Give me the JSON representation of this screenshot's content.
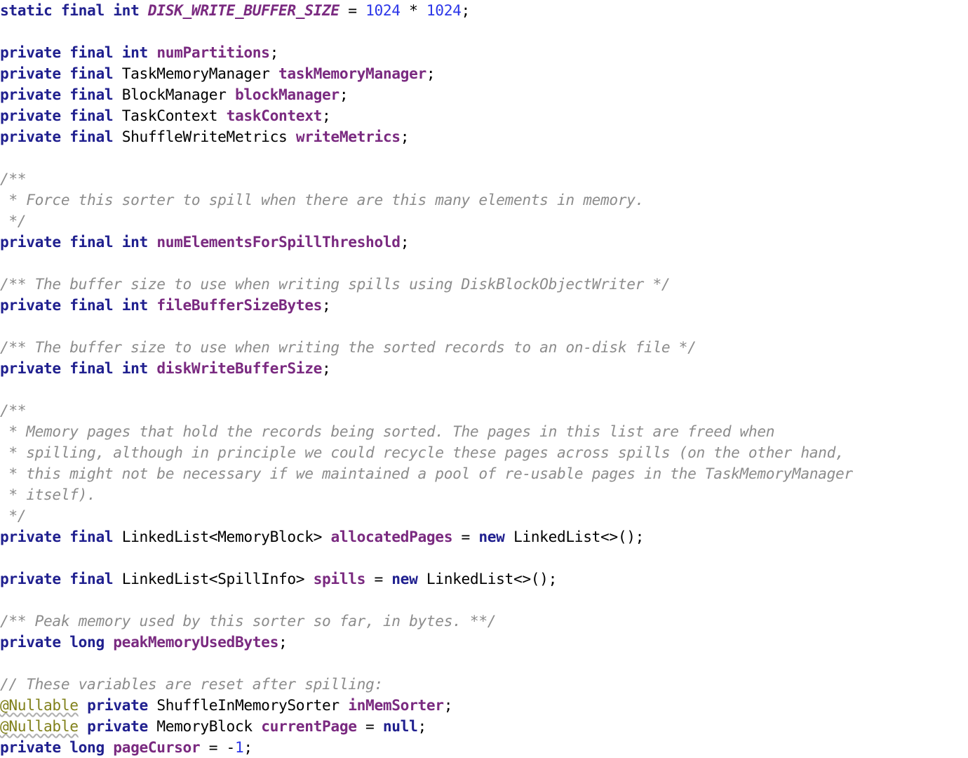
{
  "editor": {
    "language": "java",
    "background_color": "#ffffff",
    "font_size_px": 21,
    "line_height_px": 30,
    "palette": {
      "keyword": "#20208f",
      "field": "#7a2a80",
      "constant": "#7a2a80",
      "number": "#2b36e8",
      "comment": "#8c8c8c",
      "annotation": "#80801a",
      "plain": "#000000"
    }
  },
  "code": {
    "lines": [
      {
        "index": 1,
        "text": "static final int DISK_WRITE_BUFFER_SIZE = 1024 * 1024;",
        "tokens": [
          {
            "t": "static",
            "c": "keyword"
          },
          {
            "t": " ",
            "c": "plain"
          },
          {
            "t": "final",
            "c": "keyword"
          },
          {
            "t": " ",
            "c": "plain"
          },
          {
            "t": "int",
            "c": "keyword"
          },
          {
            "t": " ",
            "c": "plain"
          },
          {
            "t": "DISK_WRITE_BUFFER_SIZE",
            "c": "const"
          },
          {
            "t": " = ",
            "c": "plain"
          },
          {
            "t": "1024",
            "c": "number"
          },
          {
            "t": " * ",
            "c": "plain"
          },
          {
            "t": "1024",
            "c": "number"
          },
          {
            "t": ";",
            "c": "plain"
          }
        ]
      },
      {
        "index": 2,
        "text": "",
        "tokens": []
      },
      {
        "index": 3,
        "text": "private final int numPartitions;",
        "tokens": [
          {
            "t": "private",
            "c": "keyword"
          },
          {
            "t": " ",
            "c": "plain"
          },
          {
            "t": "final",
            "c": "keyword"
          },
          {
            "t": " ",
            "c": "plain"
          },
          {
            "t": "int",
            "c": "keyword"
          },
          {
            "t": " ",
            "c": "plain"
          },
          {
            "t": "numPartitions",
            "c": "field"
          },
          {
            "t": ";",
            "c": "plain"
          }
        ]
      },
      {
        "index": 4,
        "text": "private final TaskMemoryManager taskMemoryManager;",
        "tokens": [
          {
            "t": "private",
            "c": "keyword"
          },
          {
            "t": " ",
            "c": "plain"
          },
          {
            "t": "final",
            "c": "keyword"
          },
          {
            "t": " ",
            "c": "plain"
          },
          {
            "t": "TaskMemoryManager",
            "c": "type"
          },
          {
            "t": " ",
            "c": "plain"
          },
          {
            "t": "taskMemoryManager",
            "c": "field"
          },
          {
            "t": ";",
            "c": "plain"
          }
        ]
      },
      {
        "index": 5,
        "text": "private final BlockManager blockManager;",
        "tokens": [
          {
            "t": "private",
            "c": "keyword"
          },
          {
            "t": " ",
            "c": "plain"
          },
          {
            "t": "final",
            "c": "keyword"
          },
          {
            "t": " ",
            "c": "plain"
          },
          {
            "t": "BlockManager",
            "c": "type"
          },
          {
            "t": " ",
            "c": "plain"
          },
          {
            "t": "blockManager",
            "c": "field"
          },
          {
            "t": ";",
            "c": "plain"
          }
        ]
      },
      {
        "index": 6,
        "text": "private final TaskContext taskContext;",
        "tokens": [
          {
            "t": "private",
            "c": "keyword"
          },
          {
            "t": " ",
            "c": "plain"
          },
          {
            "t": "final",
            "c": "keyword"
          },
          {
            "t": " ",
            "c": "plain"
          },
          {
            "t": "TaskContext",
            "c": "type"
          },
          {
            "t": " ",
            "c": "plain"
          },
          {
            "t": "taskContext",
            "c": "field"
          },
          {
            "t": ";",
            "c": "plain"
          }
        ]
      },
      {
        "index": 7,
        "text": "private final ShuffleWriteMetrics writeMetrics;",
        "tokens": [
          {
            "t": "private",
            "c": "keyword"
          },
          {
            "t": " ",
            "c": "plain"
          },
          {
            "t": "final",
            "c": "keyword"
          },
          {
            "t": " ",
            "c": "plain"
          },
          {
            "t": "ShuffleWriteMetrics",
            "c": "type"
          },
          {
            "t": " ",
            "c": "plain"
          },
          {
            "t": "writeMetrics",
            "c": "field"
          },
          {
            "t": ";",
            "c": "plain"
          }
        ]
      },
      {
        "index": 8,
        "text": "",
        "tokens": []
      },
      {
        "index": 9,
        "text": "/**",
        "tokens": [
          {
            "t": "/**",
            "c": "comment"
          }
        ]
      },
      {
        "index": 10,
        "text": " * Force this sorter to spill when there are this many elements in memory.",
        "tokens": [
          {
            "t": " * Force this sorter to spill when there are this many elements in memory.",
            "c": "comment"
          }
        ]
      },
      {
        "index": 11,
        "text": " */",
        "tokens": [
          {
            "t": " */",
            "c": "comment"
          }
        ]
      },
      {
        "index": 12,
        "text": "private final int numElementsForSpillThreshold;",
        "tokens": [
          {
            "t": "private",
            "c": "keyword"
          },
          {
            "t": " ",
            "c": "plain"
          },
          {
            "t": "final",
            "c": "keyword"
          },
          {
            "t": " ",
            "c": "plain"
          },
          {
            "t": "int",
            "c": "keyword"
          },
          {
            "t": " ",
            "c": "plain"
          },
          {
            "t": "numElementsForSpillThreshold",
            "c": "field"
          },
          {
            "t": ";",
            "c": "plain"
          }
        ]
      },
      {
        "index": 13,
        "text": "",
        "tokens": []
      },
      {
        "index": 14,
        "text": "/** The buffer size to use when writing spills using DiskBlockObjectWriter */",
        "tokens": [
          {
            "t": "/** The buffer size to use when writing spills using DiskBlockObjectWriter */",
            "c": "comment"
          }
        ]
      },
      {
        "index": 15,
        "text": "private final int fileBufferSizeBytes;",
        "tokens": [
          {
            "t": "private",
            "c": "keyword"
          },
          {
            "t": " ",
            "c": "plain"
          },
          {
            "t": "final",
            "c": "keyword"
          },
          {
            "t": " ",
            "c": "plain"
          },
          {
            "t": "int",
            "c": "keyword"
          },
          {
            "t": " ",
            "c": "plain"
          },
          {
            "t": "fileBufferSizeBytes",
            "c": "field"
          },
          {
            "t": ";",
            "c": "plain"
          }
        ]
      },
      {
        "index": 16,
        "text": "",
        "tokens": []
      },
      {
        "index": 17,
        "text": "/** The buffer size to use when writing the sorted records to an on-disk file */",
        "tokens": [
          {
            "t": "/** The buffer size to use when writing the sorted records to an on-disk file */",
            "c": "comment"
          }
        ]
      },
      {
        "index": 18,
        "text": "private final int diskWriteBufferSize;",
        "tokens": [
          {
            "t": "private",
            "c": "keyword"
          },
          {
            "t": " ",
            "c": "plain"
          },
          {
            "t": "final",
            "c": "keyword"
          },
          {
            "t": " ",
            "c": "plain"
          },
          {
            "t": "int",
            "c": "keyword"
          },
          {
            "t": " ",
            "c": "plain"
          },
          {
            "t": "diskWriteBufferSize",
            "c": "field"
          },
          {
            "t": ";",
            "c": "plain"
          }
        ]
      },
      {
        "index": 19,
        "text": "",
        "tokens": []
      },
      {
        "index": 20,
        "text": "/**",
        "tokens": [
          {
            "t": "/**",
            "c": "comment"
          }
        ]
      },
      {
        "index": 21,
        "text": " * Memory pages that hold the records being sorted. The pages in this list are freed when",
        "tokens": [
          {
            "t": " * Memory pages that hold the records being sorted. The pages in this list are freed when",
            "c": "comment"
          }
        ]
      },
      {
        "index": 22,
        "text": " * spilling, although in principle we could recycle these pages across spills (on the other hand,",
        "tokens": [
          {
            "t": " * spilling, although in principle we could recycle these pages across spills (on the other hand,",
            "c": "comment"
          }
        ]
      },
      {
        "index": 23,
        "text": " * this might not be necessary if we maintained a pool of re-usable pages in the TaskMemoryManager",
        "tokens": [
          {
            "t": " * this might not be necessary if we maintained a pool of re-usable pages in the TaskMemoryManager",
            "c": "comment"
          }
        ]
      },
      {
        "index": 24,
        "text": " * itself).",
        "tokens": [
          {
            "t": " * itself).",
            "c": "comment"
          }
        ]
      },
      {
        "index": 25,
        "text": " */",
        "tokens": [
          {
            "t": " */",
            "c": "comment"
          }
        ]
      },
      {
        "index": 26,
        "text": "private final LinkedList<MemoryBlock> allocatedPages = new LinkedList<>();",
        "tokens": [
          {
            "t": "private",
            "c": "keyword"
          },
          {
            "t": " ",
            "c": "plain"
          },
          {
            "t": "final",
            "c": "keyword"
          },
          {
            "t": " ",
            "c": "plain"
          },
          {
            "t": "LinkedList<MemoryBlock>",
            "c": "type"
          },
          {
            "t": " ",
            "c": "plain"
          },
          {
            "t": "allocatedPages",
            "c": "field"
          },
          {
            "t": " = ",
            "c": "plain"
          },
          {
            "t": "new",
            "c": "keyword"
          },
          {
            "t": " ",
            "c": "plain"
          },
          {
            "t": "LinkedList<>();",
            "c": "plain"
          }
        ]
      },
      {
        "index": 27,
        "text": "",
        "tokens": []
      },
      {
        "index": 28,
        "text": "private final LinkedList<SpillInfo> spills = new LinkedList<>();",
        "tokens": [
          {
            "t": "private",
            "c": "keyword"
          },
          {
            "t": " ",
            "c": "plain"
          },
          {
            "t": "final",
            "c": "keyword"
          },
          {
            "t": " ",
            "c": "plain"
          },
          {
            "t": "LinkedList<SpillInfo>",
            "c": "type"
          },
          {
            "t": " ",
            "c": "plain"
          },
          {
            "t": "spills",
            "c": "field"
          },
          {
            "t": " = ",
            "c": "plain"
          },
          {
            "t": "new",
            "c": "keyword"
          },
          {
            "t": " ",
            "c": "plain"
          },
          {
            "t": "LinkedList<>();",
            "c": "plain"
          }
        ]
      },
      {
        "index": 29,
        "text": "",
        "tokens": []
      },
      {
        "index": 30,
        "text": "/** Peak memory used by this sorter so far, in bytes. **/",
        "tokens": [
          {
            "t": "/** Peak memory used by this sorter so far, in bytes. **/",
            "c": "comment"
          }
        ]
      },
      {
        "index": 31,
        "text": "private long peakMemoryUsedBytes;",
        "tokens": [
          {
            "t": "private",
            "c": "keyword"
          },
          {
            "t": " ",
            "c": "plain"
          },
          {
            "t": "long",
            "c": "keyword"
          },
          {
            "t": " ",
            "c": "plain"
          },
          {
            "t": "peakMemoryUsedBytes",
            "c": "field"
          },
          {
            "t": ";",
            "c": "plain"
          }
        ]
      },
      {
        "index": 32,
        "text": "",
        "tokens": []
      },
      {
        "index": 33,
        "text": "// These variables are reset after spilling:",
        "tokens": [
          {
            "t": "// These variables are reset after spilling:",
            "c": "comment"
          }
        ]
      },
      {
        "index": 34,
        "text": "@Nullable private ShuffleInMemorySorter inMemSorter;",
        "tokens": [
          {
            "t": "@Nullable",
            "c": "anno"
          },
          {
            "t": " ",
            "c": "plain"
          },
          {
            "t": "private",
            "c": "keyword"
          },
          {
            "t": " ",
            "c": "plain"
          },
          {
            "t": "ShuffleInMemorySorter",
            "c": "type"
          },
          {
            "t": " ",
            "c": "plain"
          },
          {
            "t": "inMemSorter",
            "c": "field"
          },
          {
            "t": ";",
            "c": "plain"
          }
        ]
      },
      {
        "index": 35,
        "text": "@Nullable private MemoryBlock currentPage = null;",
        "tokens": [
          {
            "t": "@Nullable",
            "c": "anno"
          },
          {
            "t": " ",
            "c": "plain"
          },
          {
            "t": "private",
            "c": "keyword"
          },
          {
            "t": " ",
            "c": "plain"
          },
          {
            "t": "MemoryBlock",
            "c": "type"
          },
          {
            "t": " ",
            "c": "plain"
          },
          {
            "t": "currentPage",
            "c": "field"
          },
          {
            "t": " = ",
            "c": "plain"
          },
          {
            "t": "null",
            "c": "keyword"
          },
          {
            "t": ";",
            "c": "plain"
          }
        ]
      },
      {
        "index": 36,
        "text": "private long pageCursor = -1;",
        "tokens": [
          {
            "t": "private",
            "c": "keyword"
          },
          {
            "t": " ",
            "c": "plain"
          },
          {
            "t": "long",
            "c": "keyword"
          },
          {
            "t": " ",
            "c": "plain"
          },
          {
            "t": "pageCursor",
            "c": "field"
          },
          {
            "t": " = -",
            "c": "plain"
          },
          {
            "t": "1",
            "c": "number"
          },
          {
            "t": ";",
            "c": "plain"
          }
        ]
      }
    ]
  }
}
